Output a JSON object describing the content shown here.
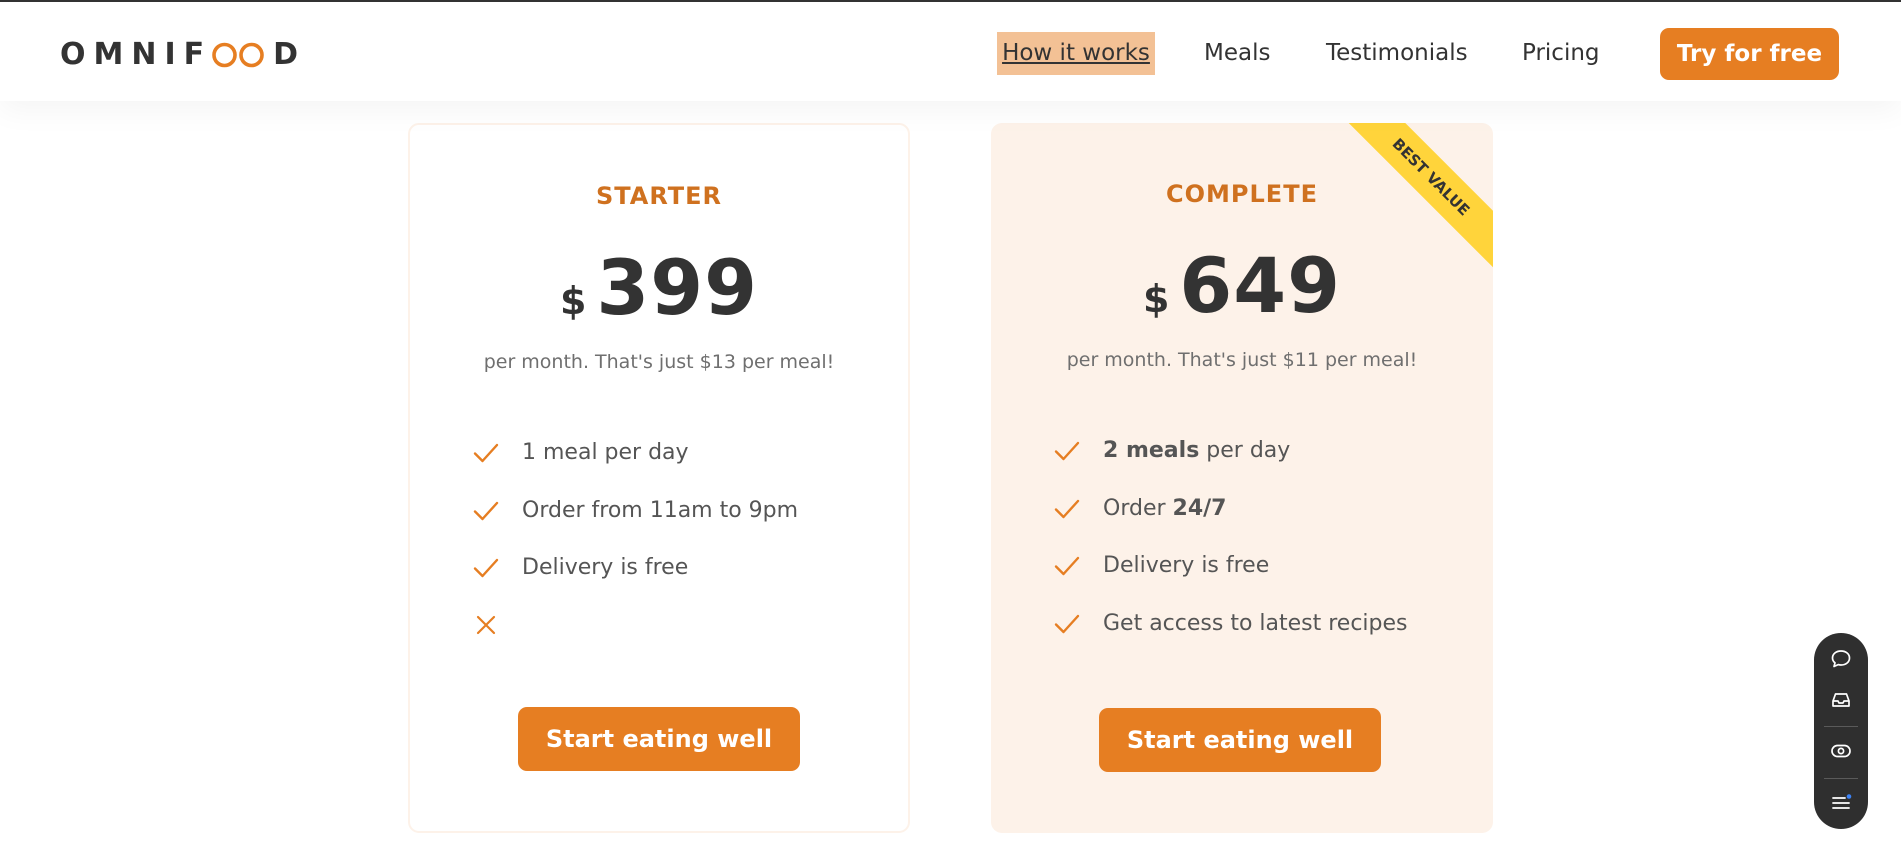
{
  "header": {
    "logo_prefix": "OMNIF",
    "logo_suffix": "D",
    "nav": {
      "how_it_works": "How it works",
      "meals": "Meals",
      "testimonials": "Testimonials",
      "pricing": "Pricing"
    },
    "cta_label": "Try for free"
  },
  "plans": [
    {
      "name": "STARTER",
      "currency": "$",
      "price": "399",
      "subtitle": "per month. That's just $13 per meal!",
      "features": [
        {
          "icon": "check-icon",
          "text": "1 meal per day"
        },
        {
          "icon": "check-icon",
          "text": "Order from 11am to 9pm"
        },
        {
          "icon": "check-icon",
          "text": "Delivery is free"
        },
        {
          "icon": "close-icon",
          "text": ""
        }
      ],
      "button": "Start eating well"
    },
    {
      "name": "COMPLETE",
      "currency": "$",
      "price": "649",
      "subtitle": "per month. That's just $11 per meal!",
      "ribbon": "BEST VALUE",
      "features": [
        {
          "icon": "check-icon",
          "bold": "2 meals",
          "text": " per day"
        },
        {
          "icon": "check-icon",
          "text": "Order ",
          "bold": "24/7"
        },
        {
          "icon": "check-icon",
          "text": "Delivery is free"
        },
        {
          "icon": "check-icon",
          "text": "Get access to latest recipes"
        }
      ],
      "button": "Start eating well"
    }
  ],
  "widget": {
    "icons": [
      "chat-icon",
      "inbox-icon",
      "eye-icon",
      "menu-icon"
    ]
  },
  "colors": {
    "accent": "#e67e22",
    "accent_dark": "#cf711f",
    "card_tint": "#fdf2e9",
    "ribbon": "#ffd43b",
    "nav_focus": "#f3c195"
  }
}
